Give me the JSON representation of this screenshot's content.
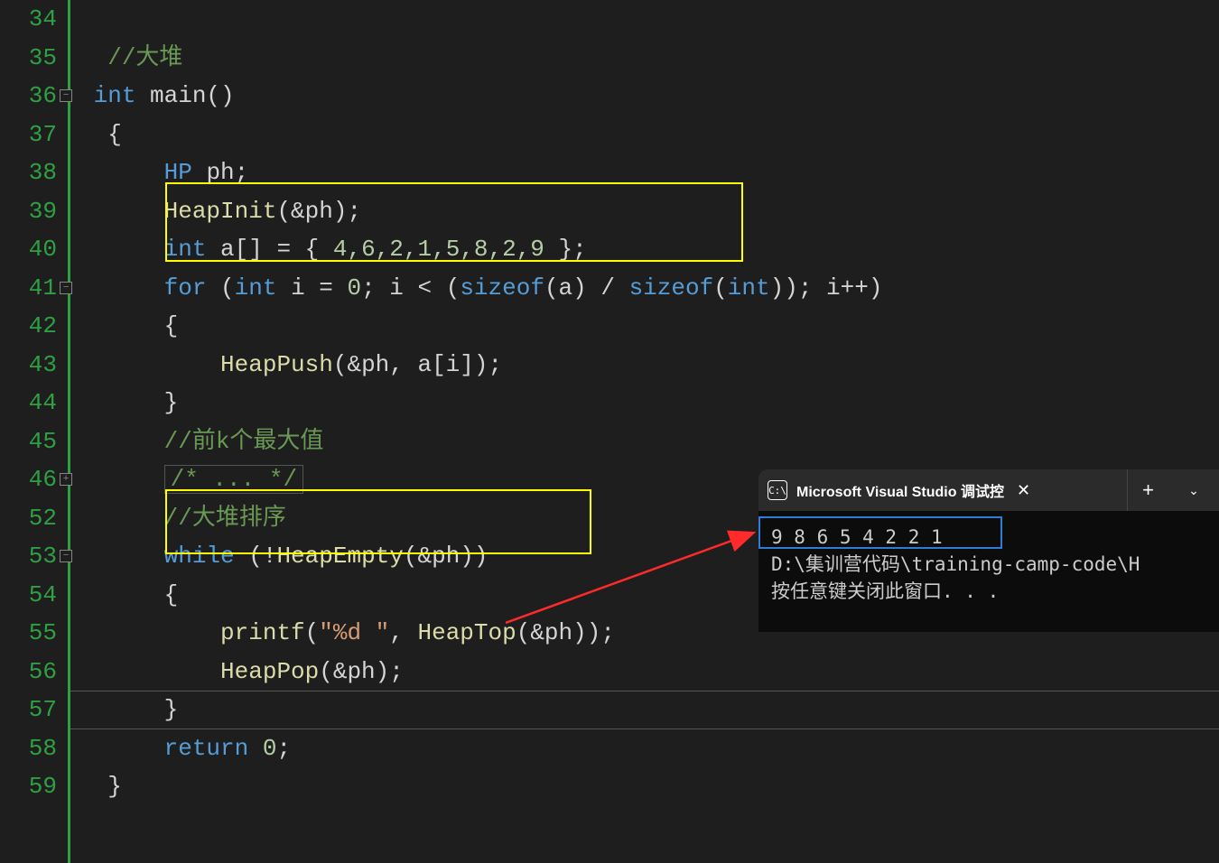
{
  "lineNumbers": [
    "34",
    "35",
    "36",
    "37",
    "38",
    "39",
    "40",
    "41",
    "42",
    "43",
    "44",
    "45",
    "46",
    "52",
    "53",
    "54",
    "55",
    "56",
    "57",
    "58",
    "59"
  ],
  "code": {
    "l34": "",
    "l35_cmt": "//大堆",
    "l36_a": "int",
    "l36_b": " main()",
    "l37": "{",
    "l38_a": "HP",
    "l38_b": " ph;",
    "l39_a": "HeapInit",
    "l39_b": "(&ph);",
    "l40_a": "int",
    "l40_b": " a[] = { ",
    "l40_c": "4,6,2,1,5,8,2,9",
    "l40_d": " };",
    "l41_a": "for",
    "l41_b": " (",
    "l41_c": "int",
    "l41_d": " i = ",
    "l41_e": "0",
    "l41_f": "; i < (",
    "l41_g": "sizeof",
    "l41_h": "(a) / ",
    "l41_i": "sizeof",
    "l41_j": "(",
    "l41_k": "int",
    "l41_l": ")); i++)",
    "l42": "{",
    "l43_a": "HeapPush",
    "l43_b": "(&ph, a[i]);",
    "l44": "}",
    "l45_cmt": "//前k个最大值",
    "l46_cmt": "/* ... */",
    "l52_cmt": "//大堆排序",
    "l53_a": "while",
    "l53_b": " (!",
    "l53_c": "HeapEmpty",
    "l53_d": "(&ph))",
    "l54": "{",
    "l55_a": "printf",
    "l55_b": "(",
    "l55_c": "\"%d \"",
    "l55_d": ", ",
    "l55_e": "HeapTop",
    "l55_f": "(&ph));",
    "l56_a": "HeapPop",
    "l56_b": "(&ph);",
    "l57": "}",
    "l58_a": "return",
    "l58_b": " ",
    "l58_c": "0",
    "l58_d": ";",
    "l59": "}"
  },
  "console": {
    "title": "Microsoft Visual Studio 调试控",
    "output_line1": "9 8 6 5 4 2 2 1",
    "output_line2": "D:\\集训营代码\\training-camp-code\\H",
    "output_line3": "按任意键关闭此窗口. . .",
    "iconText": "C:\\"
  }
}
